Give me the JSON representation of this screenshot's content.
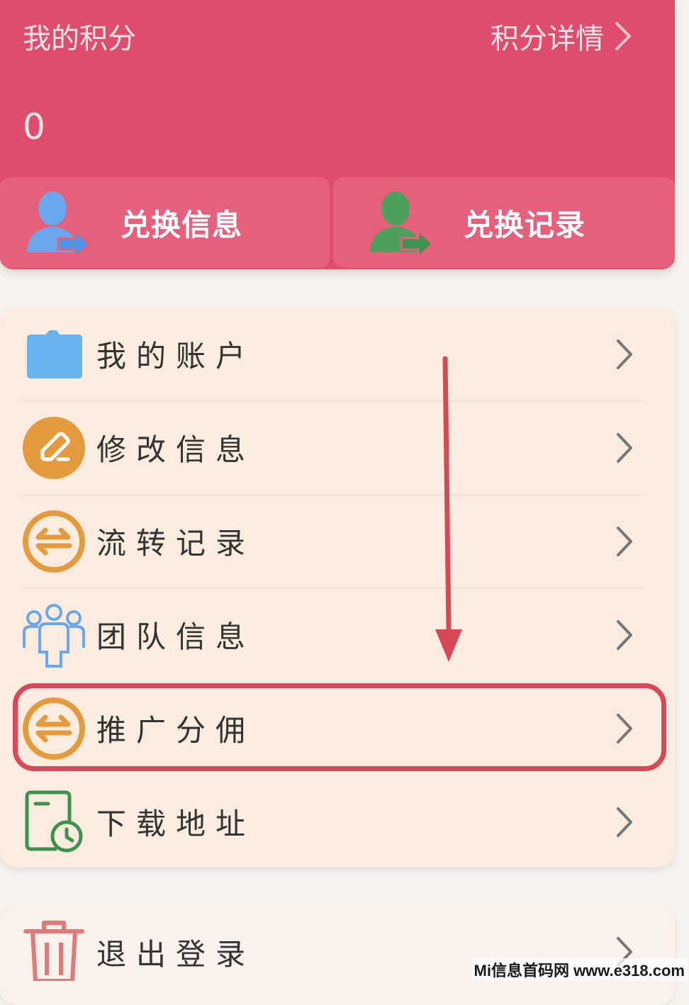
{
  "points": {
    "title": "我的积分",
    "detail_label": "积分详情",
    "value": "0"
  },
  "exchange": {
    "info_label": "兑换信息",
    "record_label": "兑换记录"
  },
  "menu": {
    "items": [
      {
        "label": "我的账户",
        "icon": "folder-icon"
      },
      {
        "label": "修改信息",
        "icon": "edit-icon"
      },
      {
        "label": "流转记录",
        "icon": "transfer-icon"
      },
      {
        "label": "团队信息",
        "icon": "team-icon"
      },
      {
        "label": "推广分佣",
        "icon": "transfer-icon"
      },
      {
        "label": "下载地址",
        "icon": "document-clock-icon"
      }
    ],
    "logout_label": "退出登录"
  },
  "watermark": "Mi信息首码网 www.e318.com",
  "colors": {
    "accent": "#e04c6c",
    "highlight": "#d94859",
    "orange": "#e59a3e",
    "menu_bg": "#faeddf"
  }
}
